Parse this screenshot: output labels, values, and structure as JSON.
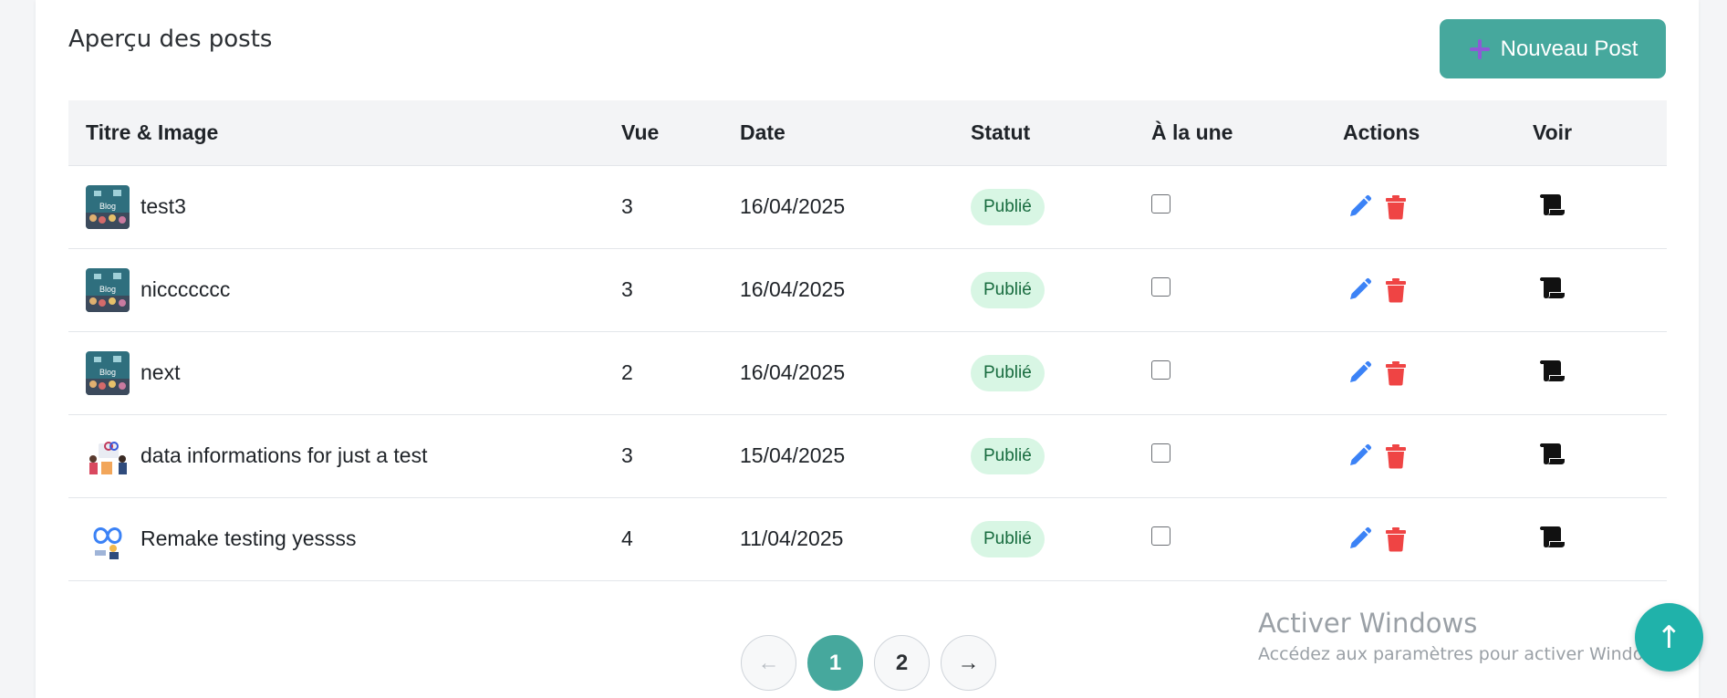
{
  "header": {
    "title": "Aperçu des posts",
    "new_post_label": "Nouveau Post"
  },
  "table": {
    "columns": [
      "Titre & Image",
      "Vue",
      "Date",
      "Statut",
      "À la une",
      "Actions",
      "Voir"
    ],
    "rows": [
      {
        "title": "test3",
        "views": "3",
        "date": "16/04/2025",
        "status": "Publié",
        "featured": false,
        "thumb": "blog-thumbnail"
      },
      {
        "title": "niccccccc",
        "views": "3",
        "date": "16/04/2025",
        "status": "Publié",
        "featured": false,
        "thumb": "blog-thumbnail"
      },
      {
        "title": "next",
        "views": "2",
        "date": "16/04/2025",
        "status": "Publié",
        "featured": false,
        "thumb": "blog-thumbnail"
      },
      {
        "title": "data informations for just a test",
        "views": "3",
        "date": "15/04/2025",
        "status": "Publié",
        "featured": false,
        "thumb": "people-illustration"
      },
      {
        "title": "Remake testing yessss",
        "views": "4",
        "date": "11/04/2025",
        "status": "Publié",
        "featured": false,
        "thumb": "infinity-illustration"
      }
    ]
  },
  "pagination": {
    "prev_label": "←",
    "pages": [
      "1",
      "2"
    ],
    "current_page": "1",
    "next_label": "→"
  },
  "watermark": {
    "line1": "Activer Windows",
    "line2": "Accédez aux paramètres pour activer Windows."
  },
  "scroll_top_label": "↑",
  "colors": {
    "accent": "#46a89d",
    "edit": "#3b82f6",
    "delete": "#ef4444",
    "badge_bg": "#d8f6e4",
    "badge_text": "#176b3e"
  }
}
